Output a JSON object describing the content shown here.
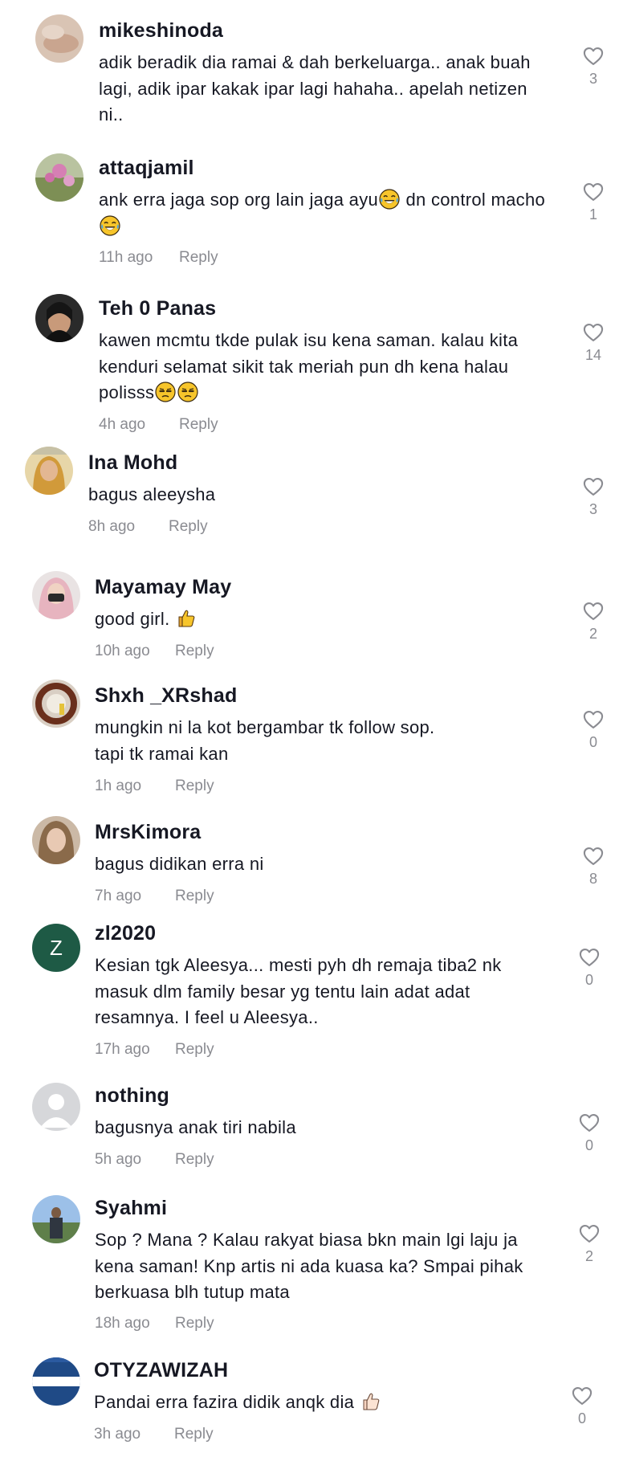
{
  "comments": [
    {
      "username": "mikeshinoda",
      "text": "adik beradik dia ramai & dah berkeluarga.. anak buah lagi, adik ipar kakak ipar lagi hahaha.. apelah netizen ni..",
      "likes": "3"
    },
    {
      "username": "attaqjamil",
      "text_parts": [
        "ank erra jaga sop org lain jaga ayu",
        " dn control macho"
      ],
      "time": "11h ago",
      "reply": "Reply",
      "likes": "1"
    },
    {
      "username": "Teh 0 Panas",
      "text": "kawen mcmtu tkde pulak isu kena saman. kalau kita kenduri selamat sikit tak meriah pun dh kena halau polisss",
      "time": "4h ago",
      "reply": "Reply",
      "likes": "14"
    },
    {
      "username": "Ina Mohd",
      "text": "bagus aleeysha",
      "time": "8h ago",
      "reply": "Reply",
      "likes": "3"
    },
    {
      "username": "Mayamay May",
      "text": "good girl.",
      "time": "10h ago",
      "reply": "Reply",
      "likes": "2"
    },
    {
      "username": "Shxh _XRshad",
      "text_line1": "mungkin ni la kot bergambar tk follow sop.",
      "text_line2": "tapi tk ramai kan",
      "time": "1h ago",
      "reply": "Reply",
      "likes": "0"
    },
    {
      "username": "MrsKimora",
      "text": "bagus didikan erra ni",
      "time": "7h ago",
      "reply": "Reply",
      "likes": "8"
    },
    {
      "username": "zl2020",
      "avatar_letter": "Z",
      "text": "Kesian tgk Aleesya... mesti pyh dh remaja tiba2 nk masuk dlm family besar yg tentu lain adat adat resamnya. I feel u Aleesya..",
      "time": "17h ago",
      "reply": "Reply",
      "likes": "0"
    },
    {
      "username": "nothing",
      "text": "bagusnya anak tiri nabila",
      "time": "5h ago",
      "reply": "Reply",
      "likes": "0"
    },
    {
      "username": "Syahmi",
      "text": "Sop ? Mana ? Kalau rakyat biasa bkn main lgi laju ja kena saman! Knp artis ni ada kuasa ka? Smpai pihak berkuasa blh tutup mata",
      "time": "18h ago",
      "reply": "Reply",
      "likes": "2"
    },
    {
      "username": "OTYZAWIZAH",
      "text": "Pandai erra fazira didik anqk dia",
      "time": "3h ago",
      "reply": "Reply",
      "likes": "0"
    }
  ],
  "colors": {
    "text": "#161823",
    "muted": "#8a8b91",
    "zl2020_avatar_bg": "#1e5a45"
  },
  "icons": {
    "like": "heart-outline-icon",
    "laugh_emoji": "tears-of-joy-emoji",
    "unamused_emoji": "unamused-face-emoji",
    "thumbs_up_emoji": "thumbs-up-emoji"
  }
}
